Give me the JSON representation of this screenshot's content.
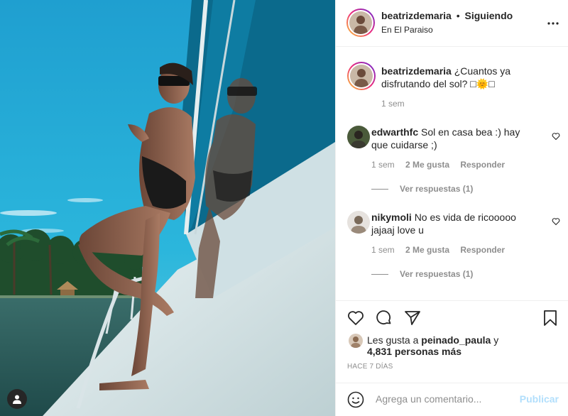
{
  "post": {
    "photo_description_icon": "person-tag-icon"
  },
  "header": {
    "username": "beatrizdemaria",
    "separator": "•",
    "follow_status": "Siguiendo",
    "location": "En El Paraiso",
    "more_icon": "more-options-icon"
  },
  "caption": {
    "username": "beatrizdemaria",
    "text": "¿Cuantos ya disfrutando del sol? □🌞□",
    "time": "1 sem"
  },
  "comments": [
    {
      "username": "edwarthfc",
      "text": "Sol en casa bea :) hay que cuidarse ;)",
      "time": "1 sem",
      "likes": "2 Me gusta",
      "reply": "Responder",
      "view_replies": "Ver respuestas (1)"
    },
    {
      "username": "nikymoli",
      "text": "No es vida de ricooooo jajaaj love u",
      "time": "1 sem",
      "likes": "2 Me gusta",
      "reply": "Responder",
      "view_replies": "Ver respuestas (1)"
    }
  ],
  "actions": {
    "like_icon": "heart-icon",
    "comment_icon": "comment-icon",
    "share_icon": "share-icon",
    "save_icon": "bookmark-icon"
  },
  "likes": {
    "prefix": "Les gusta a ",
    "user": "peinado_paula",
    "suffix": " y",
    "count_line": "4,831 personas más"
  },
  "date": "HACE 7 DÍAS",
  "add_comment": {
    "placeholder": "Agrega un comentario...",
    "publish": "Publicar"
  },
  "colors": {
    "link_disabled": "#b2dffc",
    "muted": "#8e8e8e",
    "text": "#262626",
    "border": "#efefef"
  }
}
